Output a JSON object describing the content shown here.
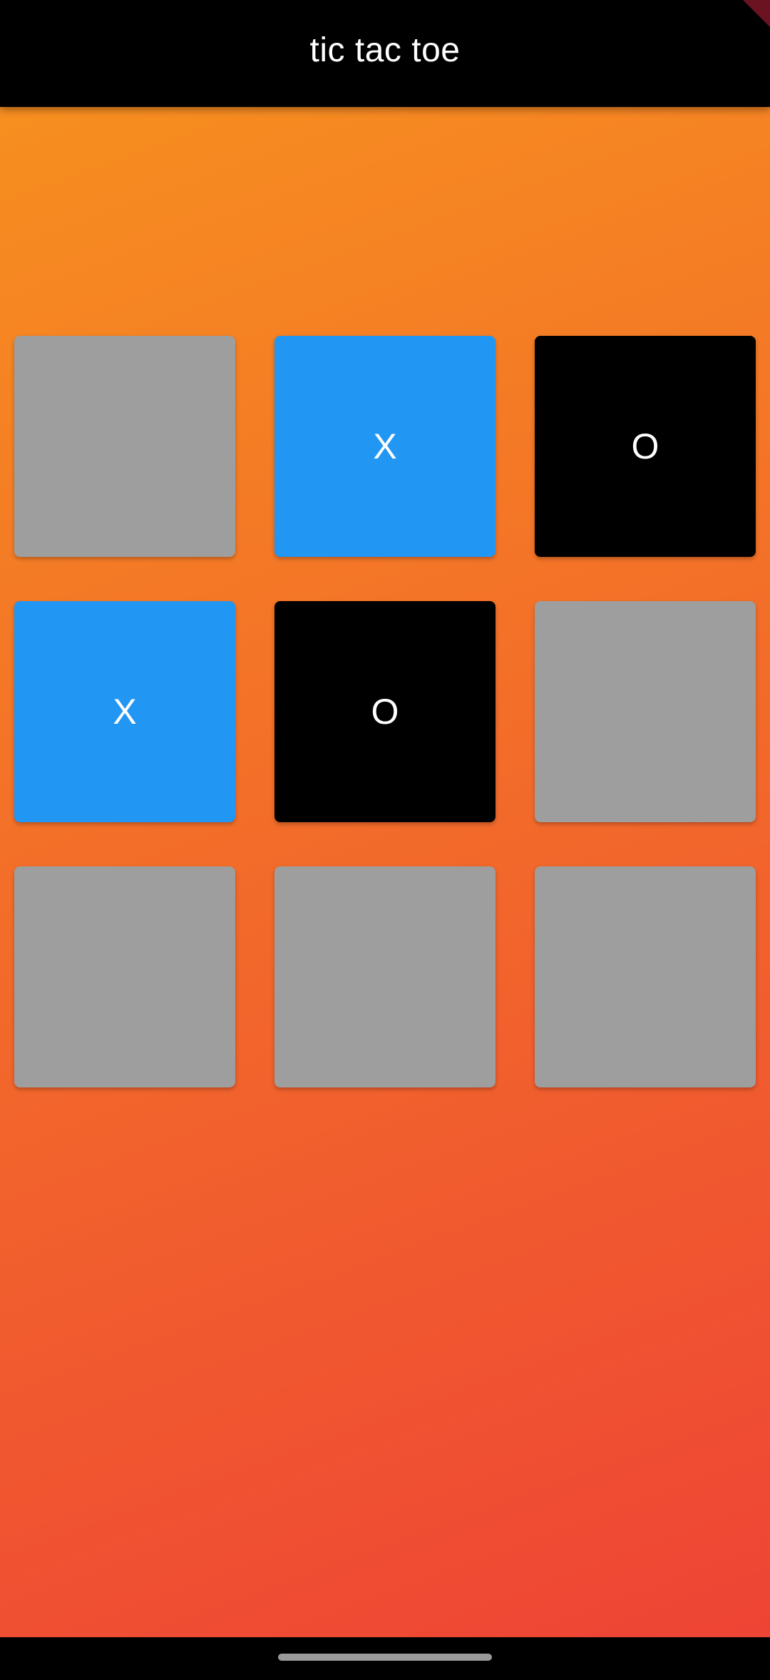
{
  "app": {
    "title": "tic tac toe"
  },
  "colors": {
    "x_tile": "#2196f3",
    "o_tile": "#000000",
    "empty_tile": "#9e9e9e",
    "background_start": "#f7931e",
    "background_end": "#ee4236"
  },
  "board": {
    "cells": [
      "",
      "X",
      "O",
      "X",
      "O",
      "",
      "",
      "",
      ""
    ]
  },
  "icons": {
    "debug_banner": "debug-banner-corner",
    "home_indicator": "gesture-bar"
  }
}
